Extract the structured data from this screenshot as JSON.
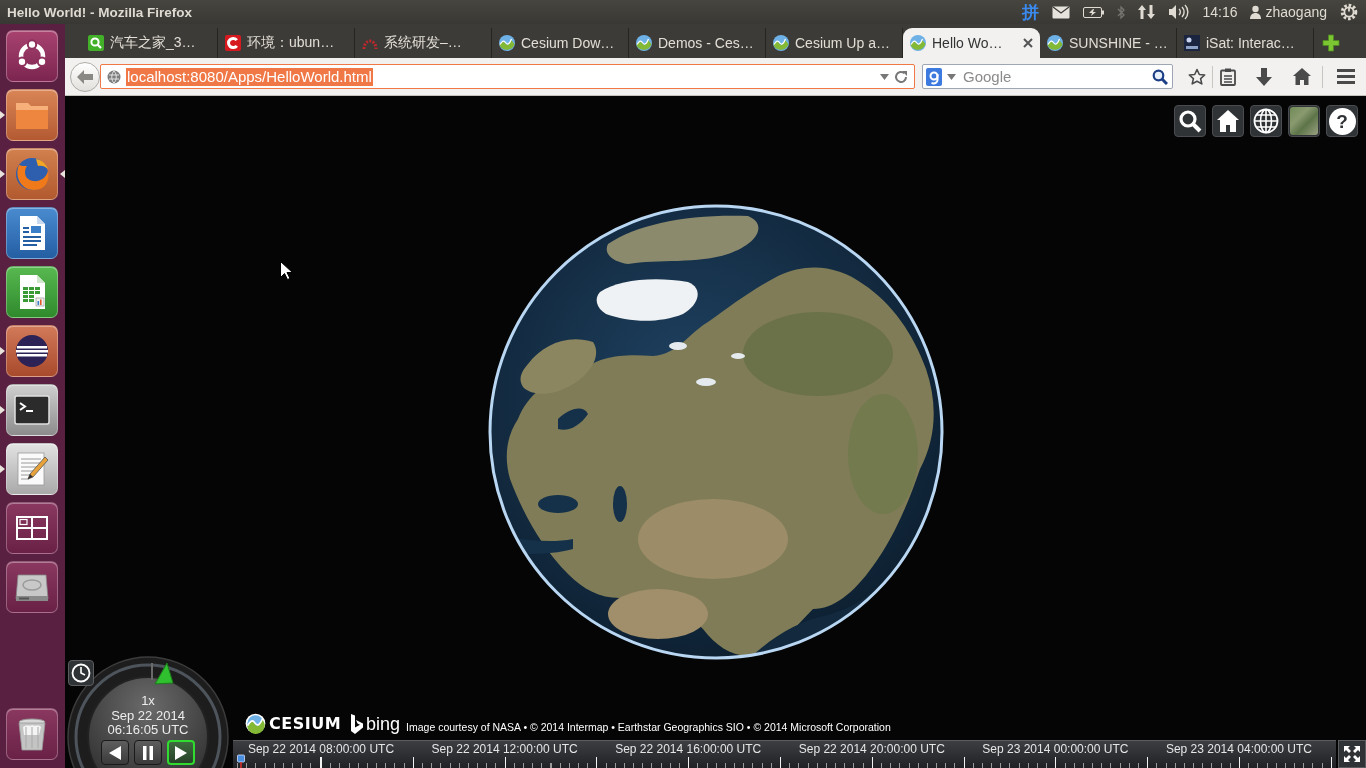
{
  "top_panel": {
    "window_title": "Hello World! - Mozilla Firefox",
    "input_method": "拼",
    "clock": "14:16",
    "user": "zhaogang"
  },
  "launcher": {
    "items": [
      {
        "kind": "dash",
        "running": false,
        "focused": false
      },
      {
        "kind": "folder",
        "running": true,
        "focused": false
      },
      {
        "kind": "browser",
        "running": true,
        "focused": true
      },
      {
        "kind": "document",
        "running": false,
        "focused": false
      },
      {
        "kind": "spreadsheet",
        "running": false,
        "focused": false
      },
      {
        "kind": "ide",
        "running": true,
        "focused": false
      },
      {
        "kind": "terminal",
        "running": true,
        "focused": false
      },
      {
        "kind": "text-editor",
        "running": true,
        "focused": false
      },
      {
        "kind": "workspaces",
        "running": false,
        "focused": false
      },
      {
        "kind": "drive",
        "running": false,
        "focused": false
      }
    ],
    "bottom_items": [
      {
        "kind": "trash",
        "running": false,
        "focused": false
      }
    ]
  },
  "tabs": [
    {
      "title": "汽车之家_3…",
      "kind": "search",
      "selected": false
    },
    {
      "title": "环境：ubun…",
      "kind": "ring",
      "selected": false
    },
    {
      "title": "系统研发–…",
      "kind": "arch",
      "selected": false
    },
    {
      "title": "Cesium Dow…",
      "kind": "wave",
      "selected": false
    },
    {
      "title": "Demos - Ces…",
      "kind": "wave",
      "selected": false
    },
    {
      "title": "Cesium Up a…",
      "kind": "wave",
      "selected": false
    },
    {
      "title": "Hello Wo…",
      "kind": "wave",
      "selected": true
    },
    {
      "title": "SUNSHINE - …",
      "kind": "wave",
      "selected": false
    },
    {
      "title": "iSat: Interac…",
      "kind": "space",
      "selected": false
    }
  ],
  "navbar": {
    "url": "localhost:8080/Apps/HelloWorld.html",
    "url_selected": true,
    "search_placeholder": "Google"
  },
  "viewer": {
    "help_label": "?",
    "animation": {
      "speed": "1x",
      "date": "Sep 22 2014",
      "time": "06:16:05 UTC",
      "buttons": [
        {
          "kind": "reverse",
          "selected": false
        },
        {
          "kind": "pause",
          "selected": false
        },
        {
          "kind": "play",
          "selected": true
        }
      ]
    },
    "credits": {
      "logo_text": "CESIUM",
      "provider_text": "bing",
      "attribution": "Image courtesy of NASA • © 2014 Intermap • Earthstar Geographics SIO • © 2014 Microsoft Corporation"
    },
    "timeline": {
      "labels": [
        "Sep 22 2014 08:00:00 UTC",
        "Sep 22 2014 12:00:00 UTC",
        "Sep 22 2014 16:00:00 UTC",
        "Sep 22 2014 20:00:00 UTC",
        "Sep 23 2014 00:00:00 UTC",
        "Sep 23 2014 04:00:00 UTC"
      ]
    }
  }
}
